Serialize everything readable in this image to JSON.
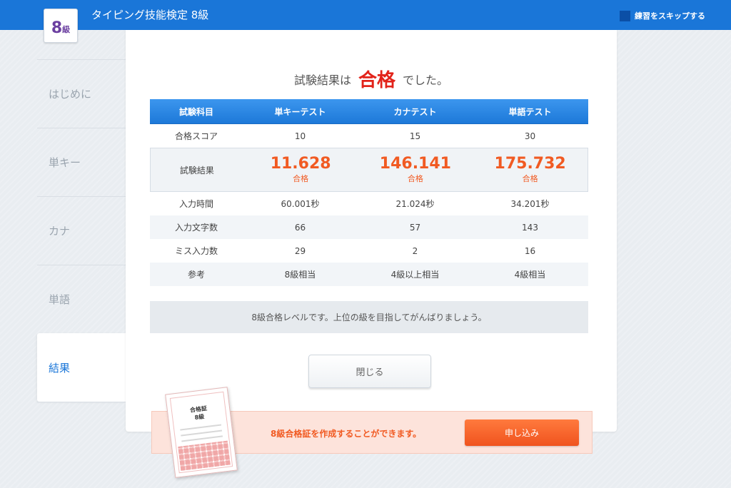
{
  "header": {
    "title": "タイピング技能検定 8級",
    "level_num": "8",
    "level_unit": "級",
    "skip_label": "練習をスキップする"
  },
  "sidebar": {
    "items": [
      {
        "label": "はじめに"
      },
      {
        "label": "単キー"
      },
      {
        "label": "カナ"
      },
      {
        "label": "単語"
      },
      {
        "label": "結果"
      }
    ]
  },
  "result": {
    "prefix": "試験結果は",
    "status": "合格",
    "suffix": "でした。"
  },
  "table": {
    "headers": [
      "試験科目",
      "単キーテスト",
      "カナテスト",
      "単語テスト"
    ],
    "pass_score": {
      "label": "合格スコア",
      "values": [
        "10",
        "15",
        "30"
      ]
    },
    "exam_result": {
      "label": "試験結果",
      "scores": [
        "11.628",
        "146.141",
        "175.732"
      ],
      "status": [
        "合格",
        "合格",
        "合格"
      ]
    },
    "input_time": {
      "label": "入力時間",
      "values": [
        "60.001秒",
        "21.024秒",
        "34.201秒"
      ]
    },
    "char_count": {
      "label": "入力文字数",
      "values": [
        "66",
        "57",
        "143"
      ]
    },
    "miss_count": {
      "label": "ミス入力数",
      "values": [
        "29",
        "2",
        "16"
      ]
    },
    "reference": {
      "label": "参考",
      "values": [
        "8級相当",
        "4級以上相当",
        "4級相当"
      ]
    }
  },
  "message": "8級合格レベルです。上位の級を目指してがんばりましょう。",
  "close_label": "閉じる",
  "certificate": {
    "text": "8級合格証を作成することができます。",
    "apply_label": "申し込み",
    "card_title": "合格証",
    "card_level": "8級"
  },
  "colors": {
    "primary": "#1a76d8",
    "pass": "#e2231a",
    "score": "#f15a22"
  }
}
